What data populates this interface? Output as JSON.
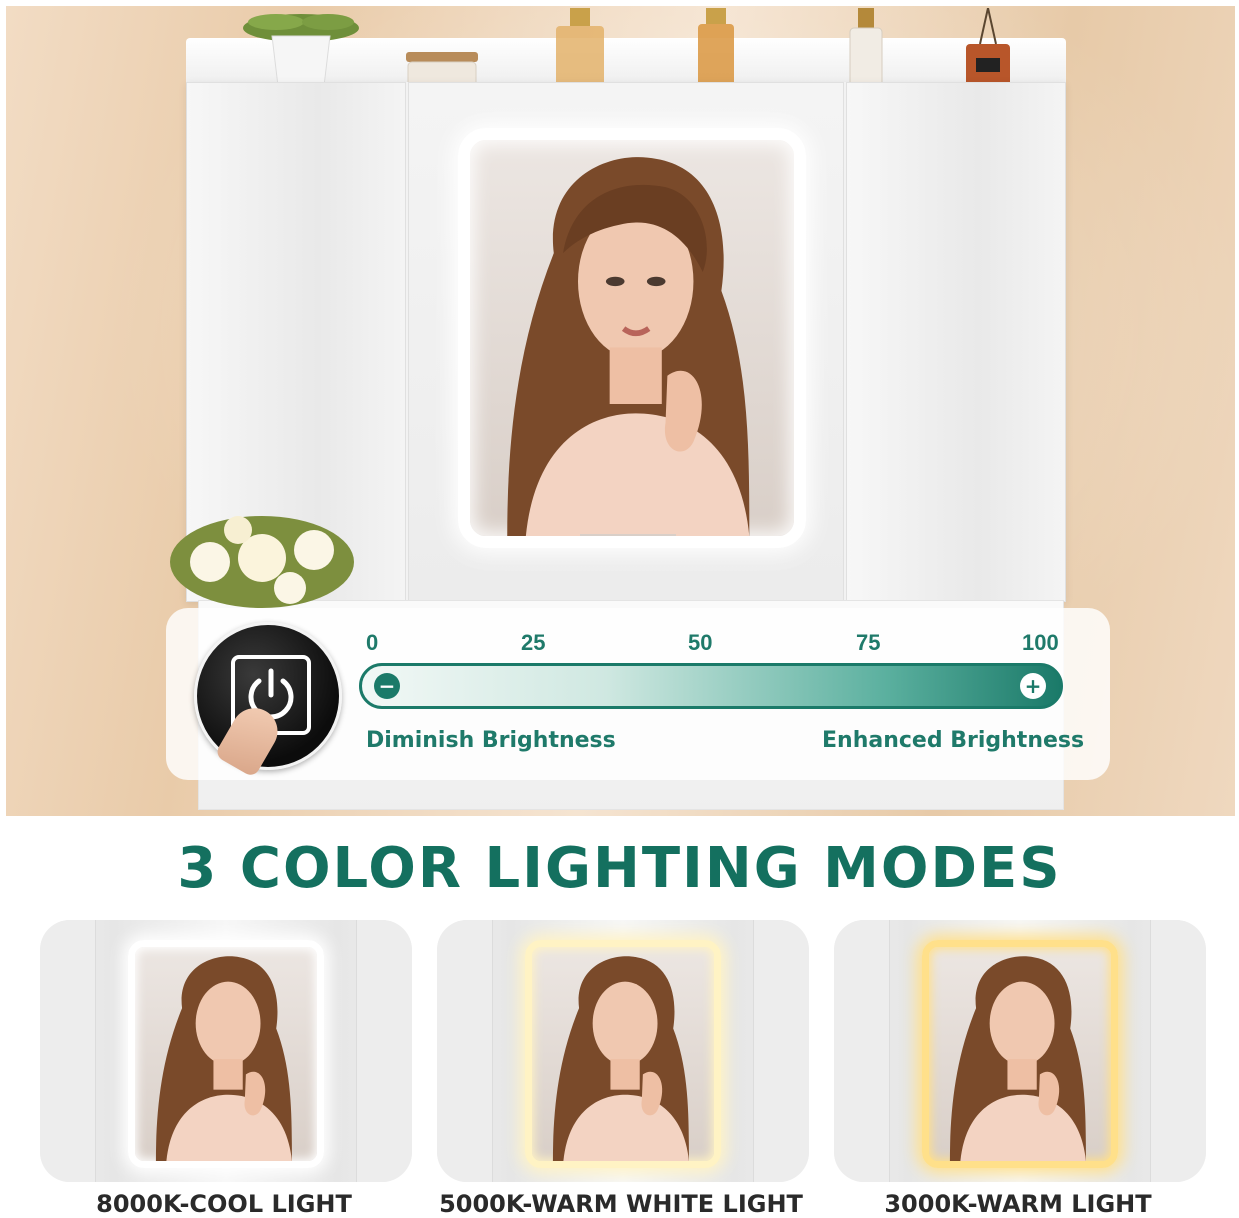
{
  "brightness": {
    "ticks": [
      "0",
      "25",
      "50",
      "75",
      "100"
    ],
    "minus_symbol": "−",
    "plus_symbol": "+",
    "diminish_label": "Diminish Brightness",
    "enhance_label": "Enhanced Brightness",
    "track_colors": [
      "#f2f8f6",
      "#1b7a69"
    ]
  },
  "modes": {
    "title": "3 COLOR LIGHTING MODES",
    "items": [
      {
        "label": "8000K-COOL LIGHT",
        "glow": "#ffffff"
      },
      {
        "label": "5000K-WARM WHITE LIGHT",
        "glow": "#fff3c4"
      },
      {
        "label": "3000K-WARM LIGHT",
        "glow": "#ffe08a"
      }
    ]
  },
  "colors": {
    "accent": "#14705f",
    "label_text": "#2a2a2a"
  },
  "icons": {
    "touch_button": "power-icon",
    "minus": "minus-circle-icon",
    "plus": "plus-circle-icon"
  }
}
